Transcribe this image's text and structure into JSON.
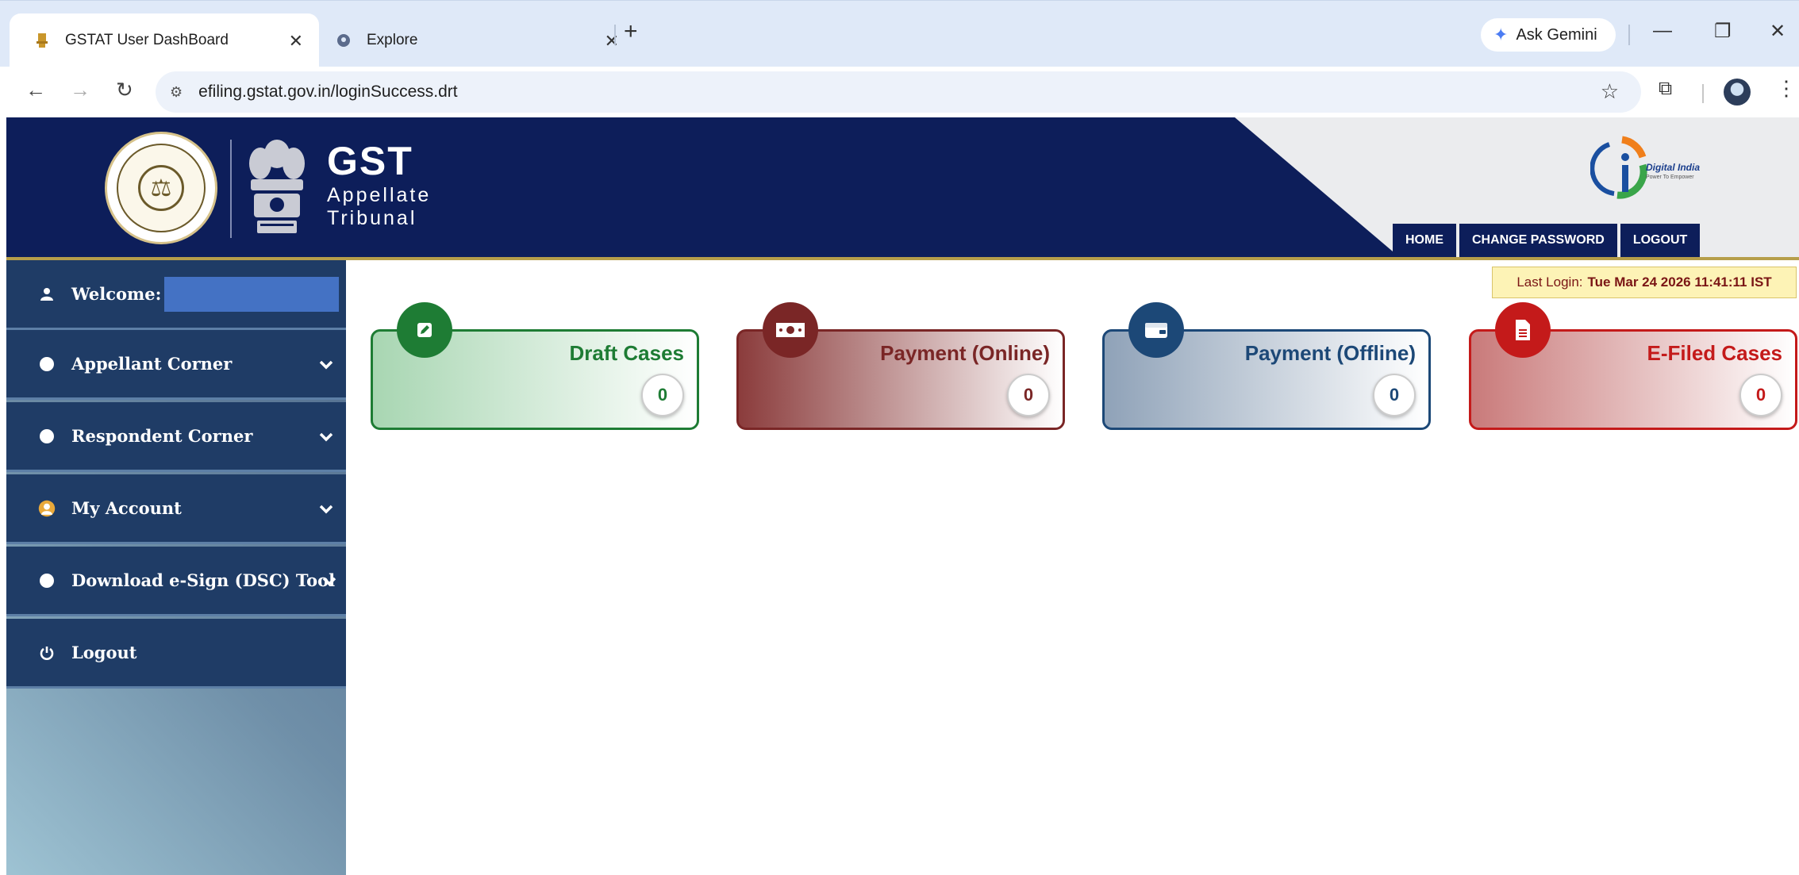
{
  "browser": {
    "tabs": [
      {
        "title": "GSTAT User DashBoard",
        "active": true
      },
      {
        "title": "Explore",
        "active": false
      }
    ],
    "new_tab": "+",
    "gemini_label": "Ask Gemini",
    "url": "efiling.gstat.gov.in/loginSuccess.drt"
  },
  "header": {
    "brand_title": "GST",
    "brand_line1": "Appellate",
    "brand_line2": "Tribunal",
    "digital_india": "Digital India",
    "digital_india_tagline": "Power To Empower",
    "nav": [
      "HOME",
      "CHANGE PASSWORD",
      "LOGOUT"
    ]
  },
  "sidebar": {
    "welcome_label": "Welcome:",
    "items": [
      {
        "label": "Appellant Corner",
        "icon": "bullet-icon",
        "expandable": true
      },
      {
        "label": "Respondent Corner",
        "icon": "bullet-icon",
        "expandable": true
      },
      {
        "label": "My Account",
        "icon": "user-avatar-icon",
        "expandable": true
      },
      {
        "label": "Download e-Sign (DSC) Tool",
        "icon": "bullet-icon",
        "expandable": true
      },
      {
        "label": "Logout",
        "icon": "power-icon",
        "expandable": false
      }
    ]
  },
  "last_login": {
    "label": "Last Login:",
    "value": "Tue Mar 24 2026 11:41:11 IST"
  },
  "cards": [
    {
      "title": "Draft Cases",
      "count": "0",
      "icon": "edit-icon",
      "color": "#1e7c34"
    },
    {
      "title": "Payment (Online)",
      "count": "0",
      "icon": "cash-icon",
      "color": "#7a2626"
    },
    {
      "title": "Payment (Offline)",
      "count": "0",
      "icon": "wallet-icon",
      "color": "#1c4877"
    },
    {
      "title": "E-Filed Cases",
      "count": "0",
      "icon": "document-icon",
      "color": "#c41a1a"
    }
  ]
}
